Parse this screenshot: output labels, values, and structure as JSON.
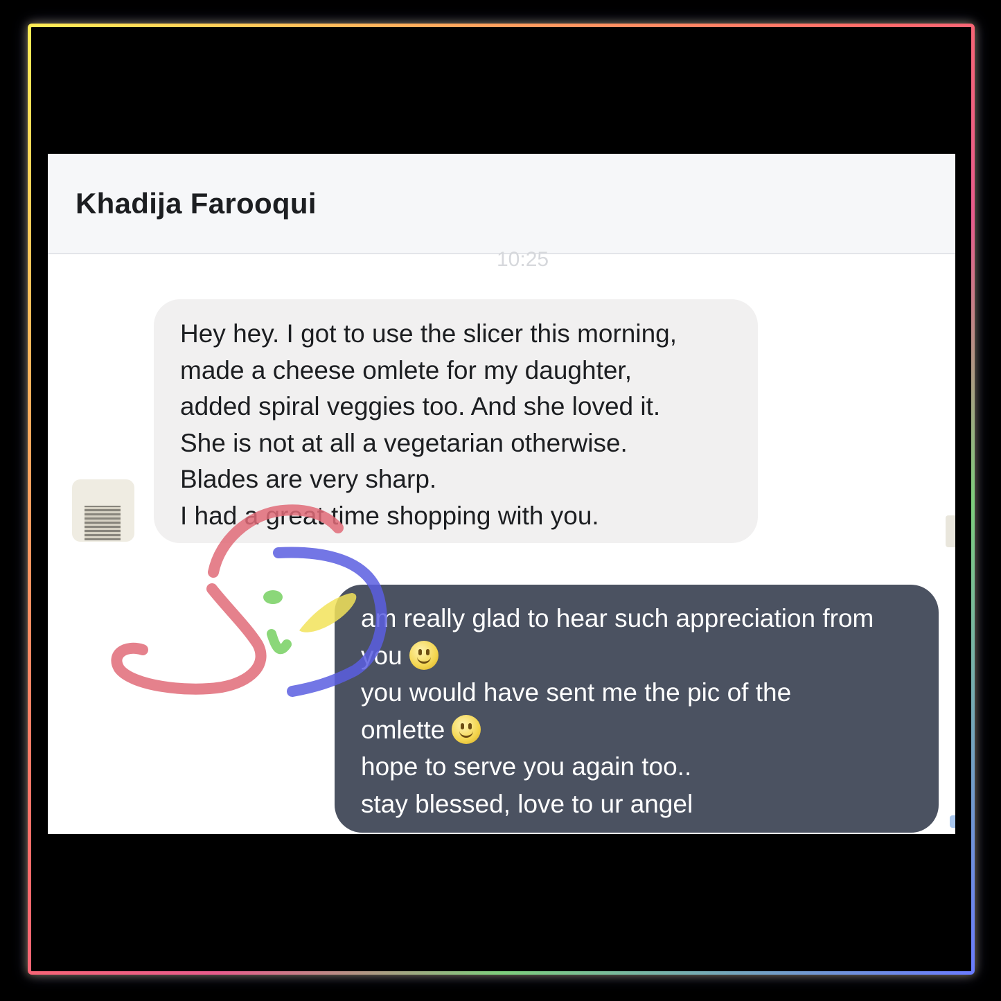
{
  "chat": {
    "contact_name": "Khadija Farooqui",
    "timestamp": "10:25"
  },
  "messages": {
    "incoming": {
      "lines": [
        "Hey hey. I got to use the slicer this morning,",
        "made a cheese omlete for my daughter,",
        "added spiral veggies too. And she loved it.",
        "She is not at all a vegetarian otherwise.",
        "Blades are very sharp.",
        "I had a great time shopping with you."
      ]
    },
    "outgoing": {
      "lines": [
        "am really glad to hear such appreciation from",
        "you",
        "you would have sent me the pic of the",
        "omlette",
        "hope to serve you again too..",
        "stay blessed, love to ur angel"
      ],
      "emoji": "slightly-smiling-face-icon"
    }
  },
  "colors": {
    "header_bg": "#f6f7f9",
    "incoming_bubble": "#f1f0f0",
    "outgoing_bubble": "#4b5261",
    "frame_gradient": [
      "#ffee55",
      "#ff6a6a",
      "#7ecf7c",
      "#6a7bff"
    ],
    "scribble_red": "#e06b78",
    "scribble_blue": "#5a5ee0",
    "scribble_green": "#7ed36a",
    "scribble_yellow": "#f2e35a"
  }
}
